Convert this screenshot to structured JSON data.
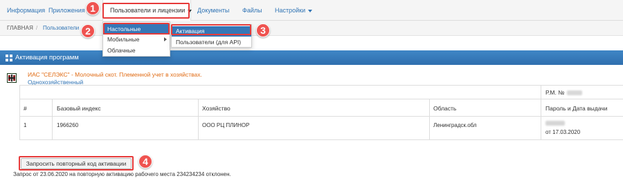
{
  "nav": {
    "items": [
      {
        "label": "Информация"
      },
      {
        "label": "Приложения"
      },
      {
        "label": "Пользователи и лицензии"
      },
      {
        "label": "Документы"
      },
      {
        "label": "Файлы"
      },
      {
        "label": "Настройки"
      }
    ]
  },
  "breadcrumb": {
    "home": "ГЛАВНАЯ",
    "separator": "/",
    "current": "Пользователи"
  },
  "menu_level1": {
    "items": [
      {
        "label": "Настольные"
      },
      {
        "label": "Мобильные"
      },
      {
        "label": "Облачные"
      }
    ]
  },
  "menu_level2": {
    "items": [
      {
        "label": "Активация"
      },
      {
        "label": "Пользователи (для API)"
      }
    ]
  },
  "panel": {
    "title": "Активация программ"
  },
  "program": {
    "name": "ИАС \"СЕЛЭКС\" - Молочный скот. Племенной учет в хозяйствах.",
    "type": "Однохозяйственный"
  },
  "table": {
    "rm_label": "Р.М. №",
    "headers": [
      "#",
      "Базовый индекс",
      "Хозяйство",
      "Область",
      "Пароль и Дата выдачи"
    ],
    "rows": [
      {
        "num": "1",
        "base_index": "1966260",
        "farm": "ООО РЦ ПЛИНОР",
        "region": "Ленинградск.обл",
        "issued": "от 17.03.2020"
      }
    ]
  },
  "actions": {
    "request_code_button": "Запросить повторный код активации"
  },
  "status": {
    "message": "Запрос от 23.06.2020 на повторную активацию рабочего места 234234234 отклонен."
  },
  "annotations": [
    "1",
    "2",
    "3",
    "4"
  ],
  "colors": {
    "link": "#3275b5",
    "highlight": "#3677b7",
    "panel_header": "#3a7fbf",
    "program_name": "#e06b14",
    "annotation_red": "#e63a3a"
  }
}
